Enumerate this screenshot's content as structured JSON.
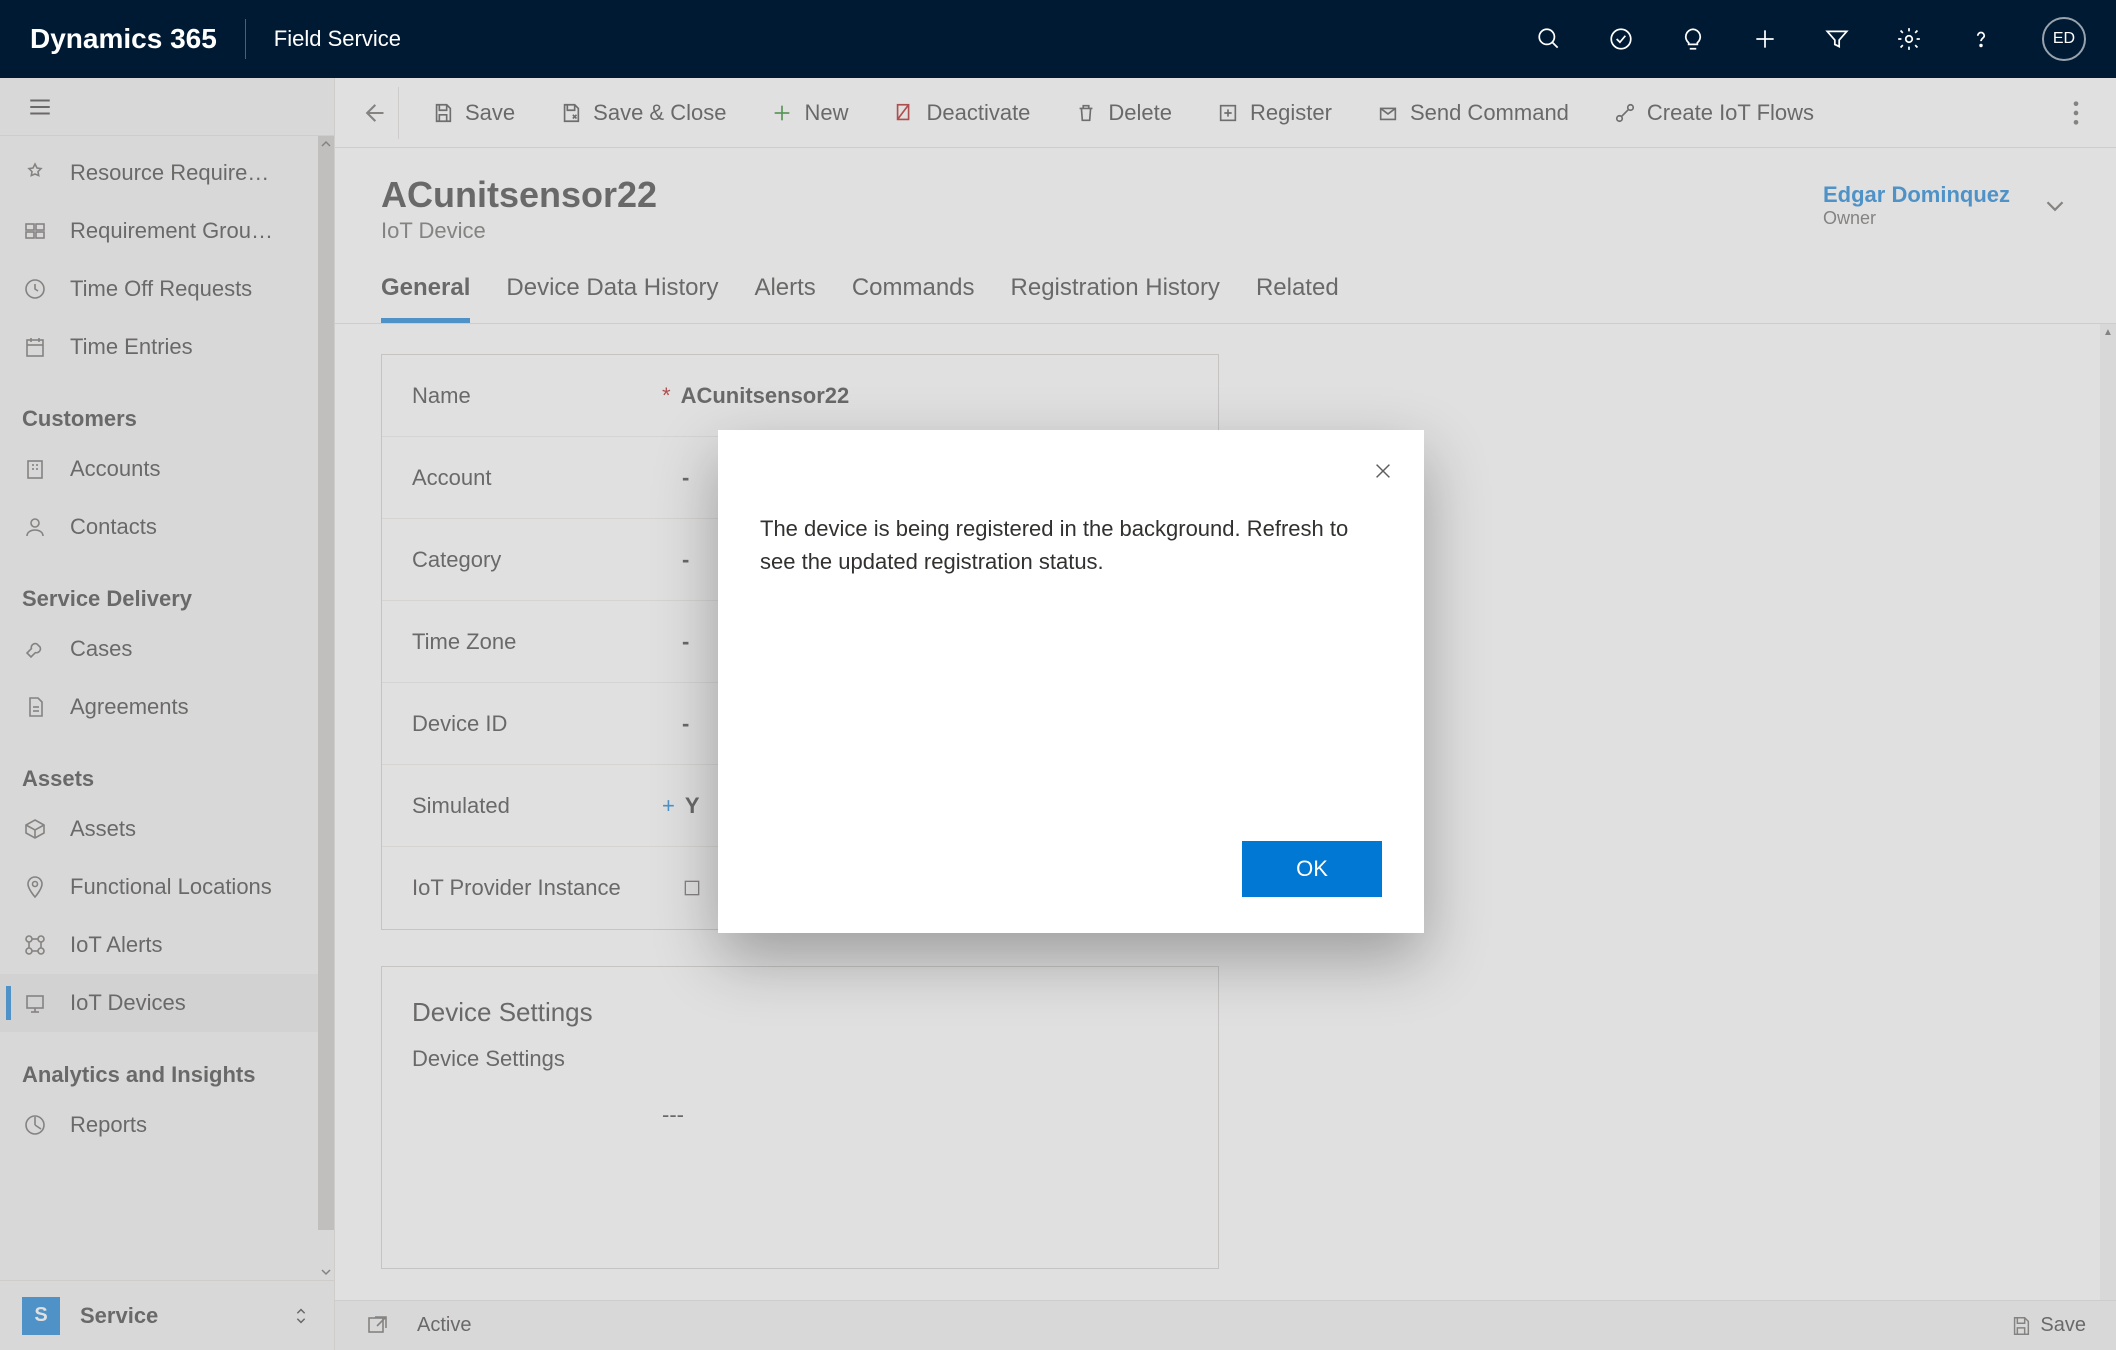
{
  "topbar": {
    "brand": "Dynamics 365",
    "module": "Field Service",
    "avatar_initials": "ED"
  },
  "sidebar": {
    "items_top": [
      {
        "label": "Resource Require…",
        "icon": "resource"
      },
      {
        "label": "Requirement Grou…",
        "icon": "group"
      },
      {
        "label": "Time Off Requests",
        "icon": "timeoff"
      },
      {
        "label": "Time Entries",
        "icon": "calendar"
      }
    ],
    "sections": [
      {
        "title": "Customers",
        "items": [
          {
            "label": "Accounts",
            "icon": "building"
          },
          {
            "label": "Contacts",
            "icon": "person"
          }
        ]
      },
      {
        "title": "Service Delivery",
        "items": [
          {
            "label": "Cases",
            "icon": "wrench"
          },
          {
            "label": "Agreements",
            "icon": "doc"
          }
        ]
      },
      {
        "title": "Assets",
        "items": [
          {
            "label": "Assets",
            "icon": "box"
          },
          {
            "label": "Functional Locations",
            "icon": "pin"
          },
          {
            "label": "IoT Alerts",
            "icon": "alert"
          },
          {
            "label": "IoT Devices",
            "icon": "device",
            "active": true
          }
        ]
      },
      {
        "title": "Analytics and Insights",
        "items": [
          {
            "label": "Reports",
            "icon": "report"
          }
        ]
      }
    ],
    "area": {
      "badge": "S",
      "label": "Service"
    }
  },
  "commands": [
    {
      "label": "Save",
      "icon": "save",
      "color": "#3b3a39"
    },
    {
      "label": "Save & Close",
      "icon": "saveclose",
      "color": "#3b3a39"
    },
    {
      "label": "New",
      "icon": "plus",
      "color": "#107c10"
    },
    {
      "label": "Deactivate",
      "icon": "deactivate",
      "color": "#a80000"
    },
    {
      "label": "Delete",
      "icon": "trash",
      "color": "#3b3a39"
    },
    {
      "label": "Register",
      "icon": "register",
      "color": "#3b3a39"
    },
    {
      "label": "Send Command",
      "icon": "send",
      "color": "#3b3a39"
    },
    {
      "label": "Create IoT Flows",
      "icon": "flow",
      "color": "#3b3a39"
    }
  ],
  "record": {
    "title": "ACunitsensor22",
    "entity": "IoT Device",
    "owner": {
      "name": "Edgar Dominquez",
      "label": "Owner"
    }
  },
  "tabs": [
    "General",
    "Device Data History",
    "Alerts",
    "Commands",
    "Registration History",
    "Related"
  ],
  "active_tab": "General",
  "form": {
    "rows": [
      {
        "label": "Name",
        "req": "*",
        "value": "ACunitsensor22"
      },
      {
        "label": "Account",
        "req": "",
        "value": "-"
      },
      {
        "label": "Category",
        "req": "",
        "value": "-"
      },
      {
        "label": "Time Zone",
        "req": "",
        "value": "-"
      },
      {
        "label": "Device ID",
        "req": "",
        "value": "-"
      },
      {
        "label": "Simulated",
        "rec": "+",
        "value": "Y"
      },
      {
        "label": "IoT Provider Instance",
        "req": "",
        "value": "",
        "link": true
      }
    ],
    "section2_title": "Device Settings",
    "ds_label": "Device Settings",
    "ds_value": "---"
  },
  "footer": {
    "status": "Active",
    "save": "Save"
  },
  "modal": {
    "message": "The device is being registered in the background. Refresh to see the updated registration status.",
    "ok": "OK"
  }
}
